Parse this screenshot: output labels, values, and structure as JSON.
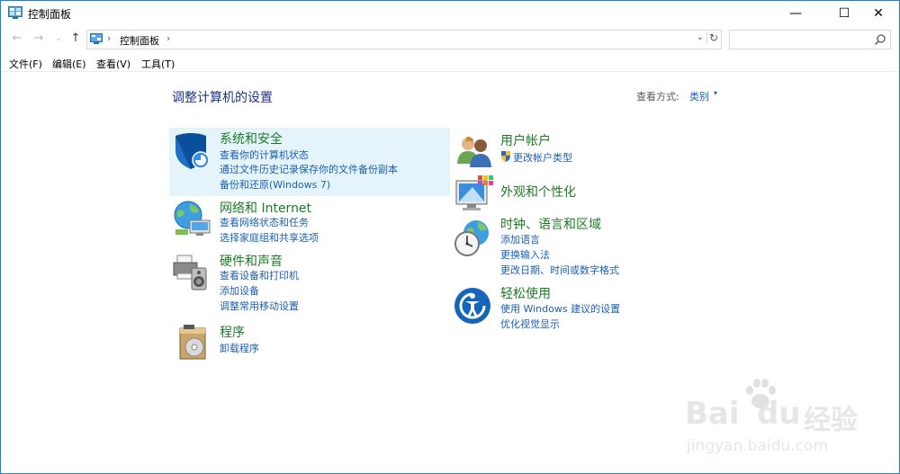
{
  "window": {
    "title": "控制面板",
    "min_glyph": "—",
    "max_glyph": "☐",
    "close_glyph": "✕"
  },
  "nav": {
    "back_glyph": "←",
    "forward_glyph": "→",
    "recent_glyph": "⌄",
    "up_glyph": "↑",
    "address_sep1": "›",
    "address_path": "控制面板",
    "address_sep2": "›",
    "dropdown_glyph": "⌄",
    "refresh_glyph": "↻",
    "search_placeholder": ""
  },
  "menu": {
    "items": [
      "文件(F)",
      "编辑(E)",
      "查看(V)",
      "工具(T)"
    ]
  },
  "main": {
    "heading": "调整计算机的设置",
    "view_by_label": "查看方式:",
    "view_by_value": "类别",
    "view_by_caret": "▾"
  },
  "categories": [
    {
      "title": "系统和安全",
      "icon": "shield-icon",
      "links": [
        "查看你的计算机状态",
        "通过文件历史记录保存你的文件备份副本",
        "备份和还原(Windows 7)"
      ]
    },
    {
      "title": "网络和 Internet",
      "icon": "globe-network-icon",
      "links": [
        "查看网络状态和任务",
        "选择家庭组和共享选项"
      ]
    },
    {
      "title": "硬件和声音",
      "icon": "printer-speaker-icon",
      "links": [
        "查看设备和打印机",
        "添加设备",
        "调整常用移动设置"
      ]
    },
    {
      "title": "程序",
      "icon": "programs-disc-icon",
      "links": [
        "卸载程序"
      ]
    },
    {
      "title": "用户帐户",
      "icon": "users-icon",
      "links": [
        "更改帐户类型"
      ]
    },
    {
      "title": "外观和个性化",
      "icon": "monitor-colors-icon",
      "links": []
    },
    {
      "title": "时钟、语言和区域",
      "icon": "clock-globe-icon",
      "links": [
        "添加语言",
        "更换输入法",
        "更改日期、时间或数字格式"
      ]
    },
    {
      "title": "轻松使用",
      "icon": "ease-of-access-icon",
      "links": [
        "使用 Windows 建议的设置",
        "优化视觉显示"
      ]
    }
  ],
  "watermark": {
    "brand": "Bai",
    "brand2": "du",
    "brand_cn": "经验",
    "url": "jingyan.baidu.com"
  },
  "colors": {
    "title_green": "#1e7a27",
    "link_blue": "#1a5fb4",
    "heading_blue": "#1e3287",
    "highlight": "#e5f3fb"
  }
}
